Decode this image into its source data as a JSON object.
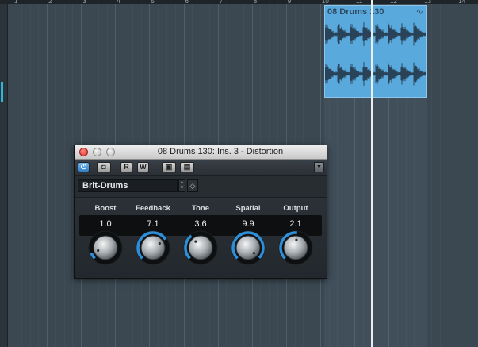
{
  "ruler": {
    "numbers": [
      "1",
      "2",
      "3",
      "4",
      "5",
      "6",
      "7",
      "8",
      "9",
      "10",
      "11",
      "12",
      "13",
      "14"
    ]
  },
  "event": {
    "title": "08 Drums 130",
    "color": "#5aa9dc"
  },
  "plugin": {
    "window_title": "08 Drums 130: Ins. 3 - Distortion",
    "toolbar": {
      "power_icon": "power-icon",
      "bypass_icon": "bypass-icon",
      "read_label": "R",
      "write_label": "W",
      "ab_icon": "ab-switch-icon",
      "copy_icon": "copy-settings-icon",
      "menu_icon": "chevron-down-icon"
    },
    "preset": {
      "name": "Brit-Drums",
      "save_icon": "save-preset-icon"
    },
    "params": [
      {
        "label": "Boost",
        "value": "1.0",
        "fraction": 0.09
      },
      {
        "label": "Feedback",
        "value": "7.1",
        "fraction": 0.71
      },
      {
        "label": "Tone",
        "value": "3.6",
        "fraction": 0.36
      },
      {
        "label": "Spatial",
        "value": "9.9",
        "fraction": 0.99
      },
      {
        "label": "Output",
        "value": "2.1",
        "fraction": 0.52
      }
    ],
    "accent_color": "#2f8fd6"
  }
}
